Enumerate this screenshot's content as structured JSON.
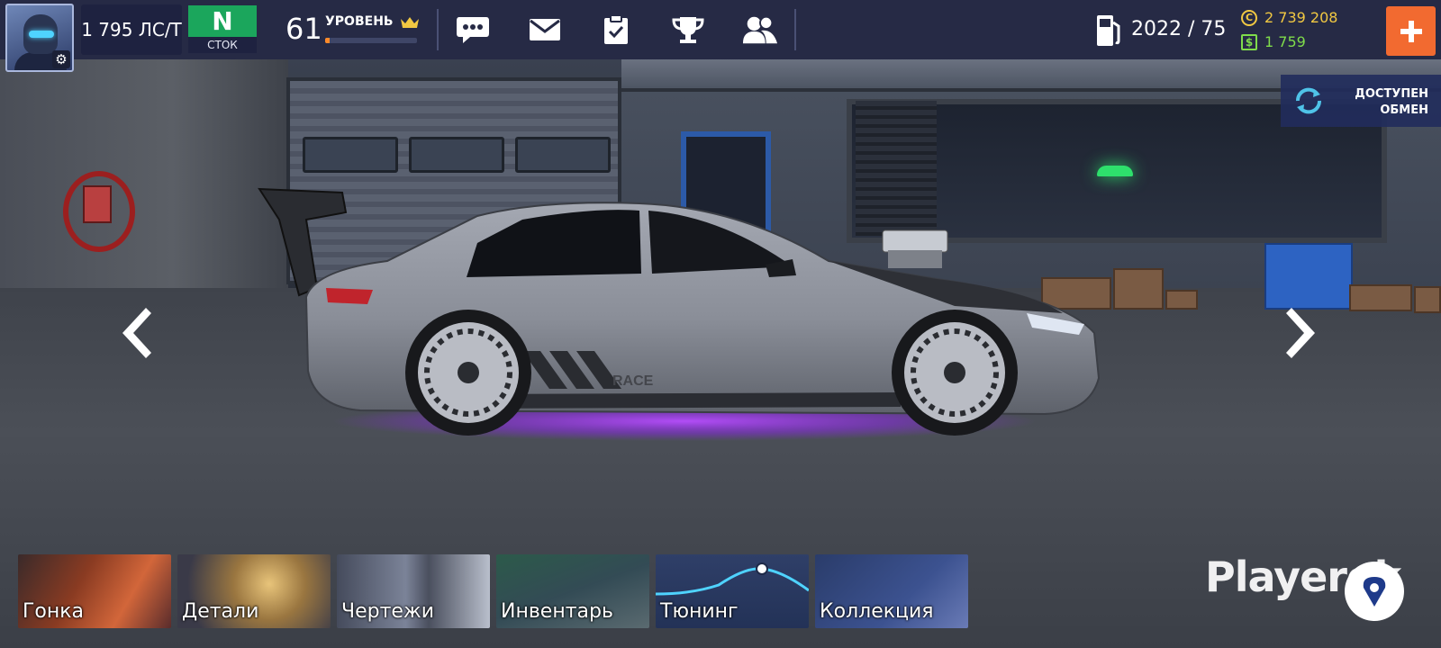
{
  "topbar": {
    "power": "1 795 ЛС/Т",
    "car_class": {
      "letter": "N",
      "label": "СТОК"
    },
    "level": {
      "number": "61",
      "label": "УРОВЕНЬ",
      "progress": 0.05
    },
    "icons": [
      "chat-icon",
      "mail-icon",
      "tasks-icon",
      "trophy-icon",
      "friends-icon"
    ],
    "fuel": "2022 / 75",
    "gold": "2 739 208",
    "cash": "1 759",
    "colors": {
      "bar": "#262a45",
      "class_green": "#1ba65c",
      "plus_orange": "#f26a30",
      "gold": "#f1c842",
      "cash": "#7fdc4b"
    }
  },
  "exchange": {
    "line1": "ДОСТУПЕН",
    "line2": "ОБМЕН"
  },
  "menu": [
    {
      "id": "race",
      "label": "Гонка"
    },
    {
      "id": "parts",
      "label": "Детали"
    },
    {
      "id": "blueprints",
      "label": "Чертежи"
    },
    {
      "id": "inventory",
      "label": "Инвентарь"
    },
    {
      "id": "tuning",
      "label": "Тюнинг"
    },
    {
      "id": "collection",
      "label": "Коллекция"
    }
  ],
  "watermark": "Playerok",
  "car": {
    "decal": "RACE",
    "underglow": "#9b30ff"
  }
}
